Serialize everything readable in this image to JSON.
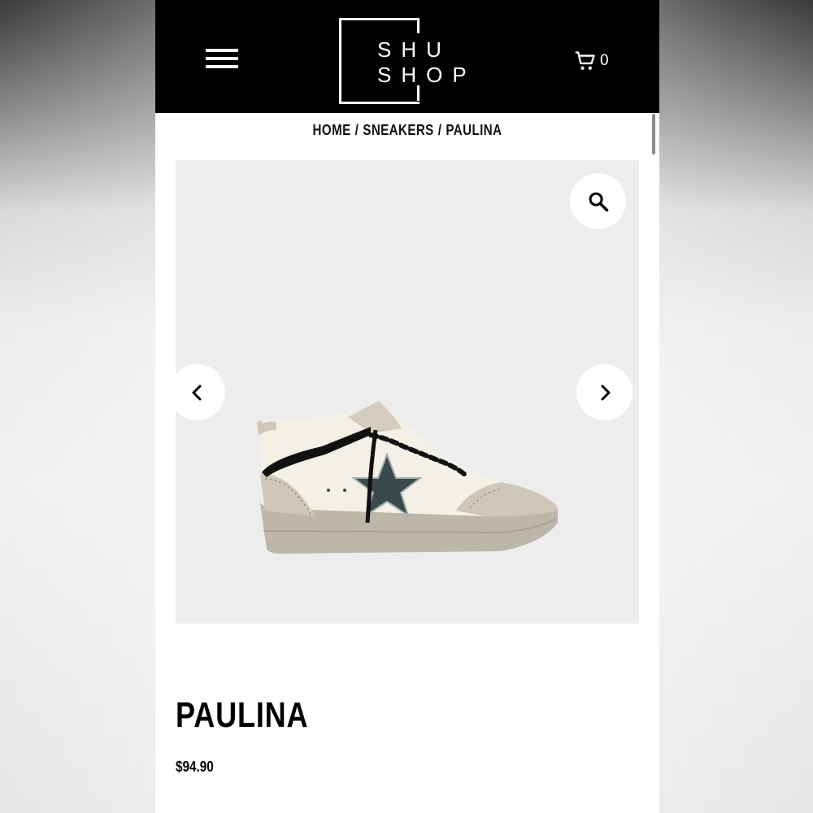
{
  "header": {
    "logo_line1": "SHU",
    "logo_line2": "SHOP",
    "cart_count": "0",
    "background": "#000000"
  },
  "breadcrumb": {
    "items": [
      "HOME",
      "SNEAKERS",
      "PAULINA"
    ],
    "separator": "/"
  },
  "gallery": {
    "background": "#ededed",
    "icons": [
      "search-icon",
      "chevron-left-icon",
      "chevron-right-icon"
    ]
  },
  "product": {
    "title": "PAULINA",
    "price": "$94.90"
  }
}
